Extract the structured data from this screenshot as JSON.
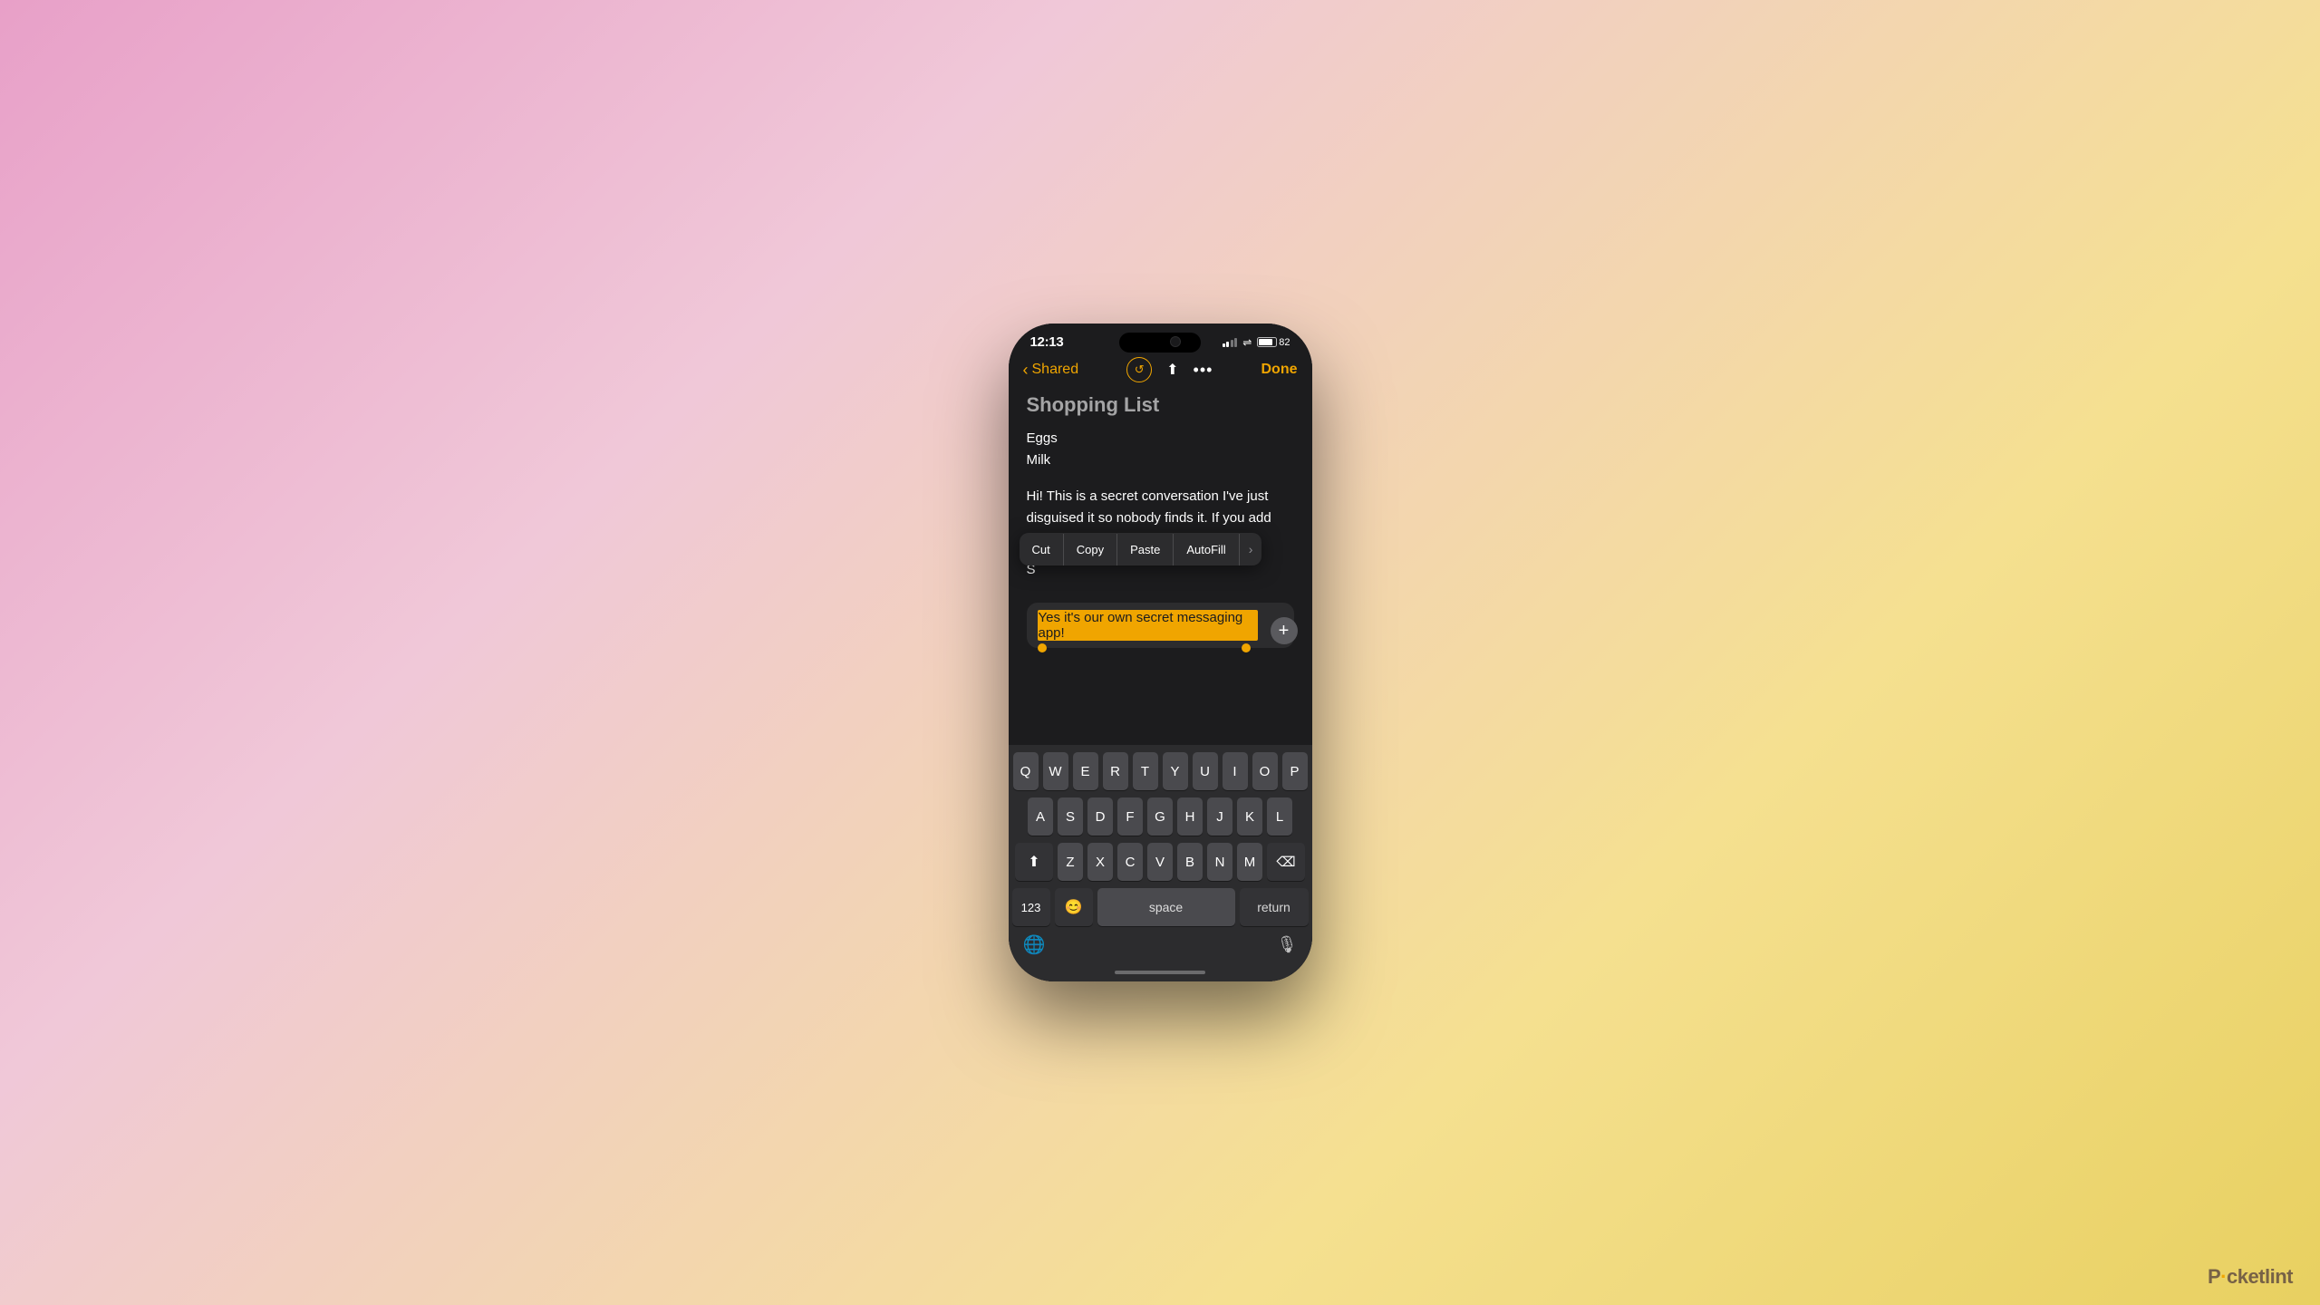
{
  "status_bar": {
    "time": "12:13",
    "battery_percent": "82"
  },
  "nav": {
    "back_label": "Shared",
    "done_label": "Done",
    "undo_icon": "↺",
    "upload_icon": "↑",
    "ellipsis_icon": "···"
  },
  "note": {
    "title": "Shopping List",
    "list_items": [
      "Eggs",
      "Milk"
    ],
    "message": "Hi! This is a secret conversation I've just disguised it so nobody finds it. If you add your reply below I can see it too.",
    "reply_prefix": "S",
    "reply_text": "Yes it's our own secret messaging app!"
  },
  "context_menu": {
    "cut": "Cut",
    "copy": "Copy",
    "paste": "Paste",
    "autofill": "AutoFill",
    "more": "›"
  },
  "keyboard": {
    "row1": [
      "Q",
      "W",
      "E",
      "R",
      "T",
      "Y",
      "U",
      "I",
      "O",
      "P"
    ],
    "row2": [
      "A",
      "S",
      "D",
      "F",
      "G",
      "H",
      "J",
      "K",
      "L"
    ],
    "row3": [
      "Z",
      "X",
      "C",
      "V",
      "B",
      "N",
      "M"
    ],
    "space_label": "space",
    "return_label": "return",
    "nums_label": "123",
    "delete_label": "⌫"
  },
  "watermark": {
    "text_p": "P",
    "dot": "·",
    "text_rest": "cketlint"
  }
}
